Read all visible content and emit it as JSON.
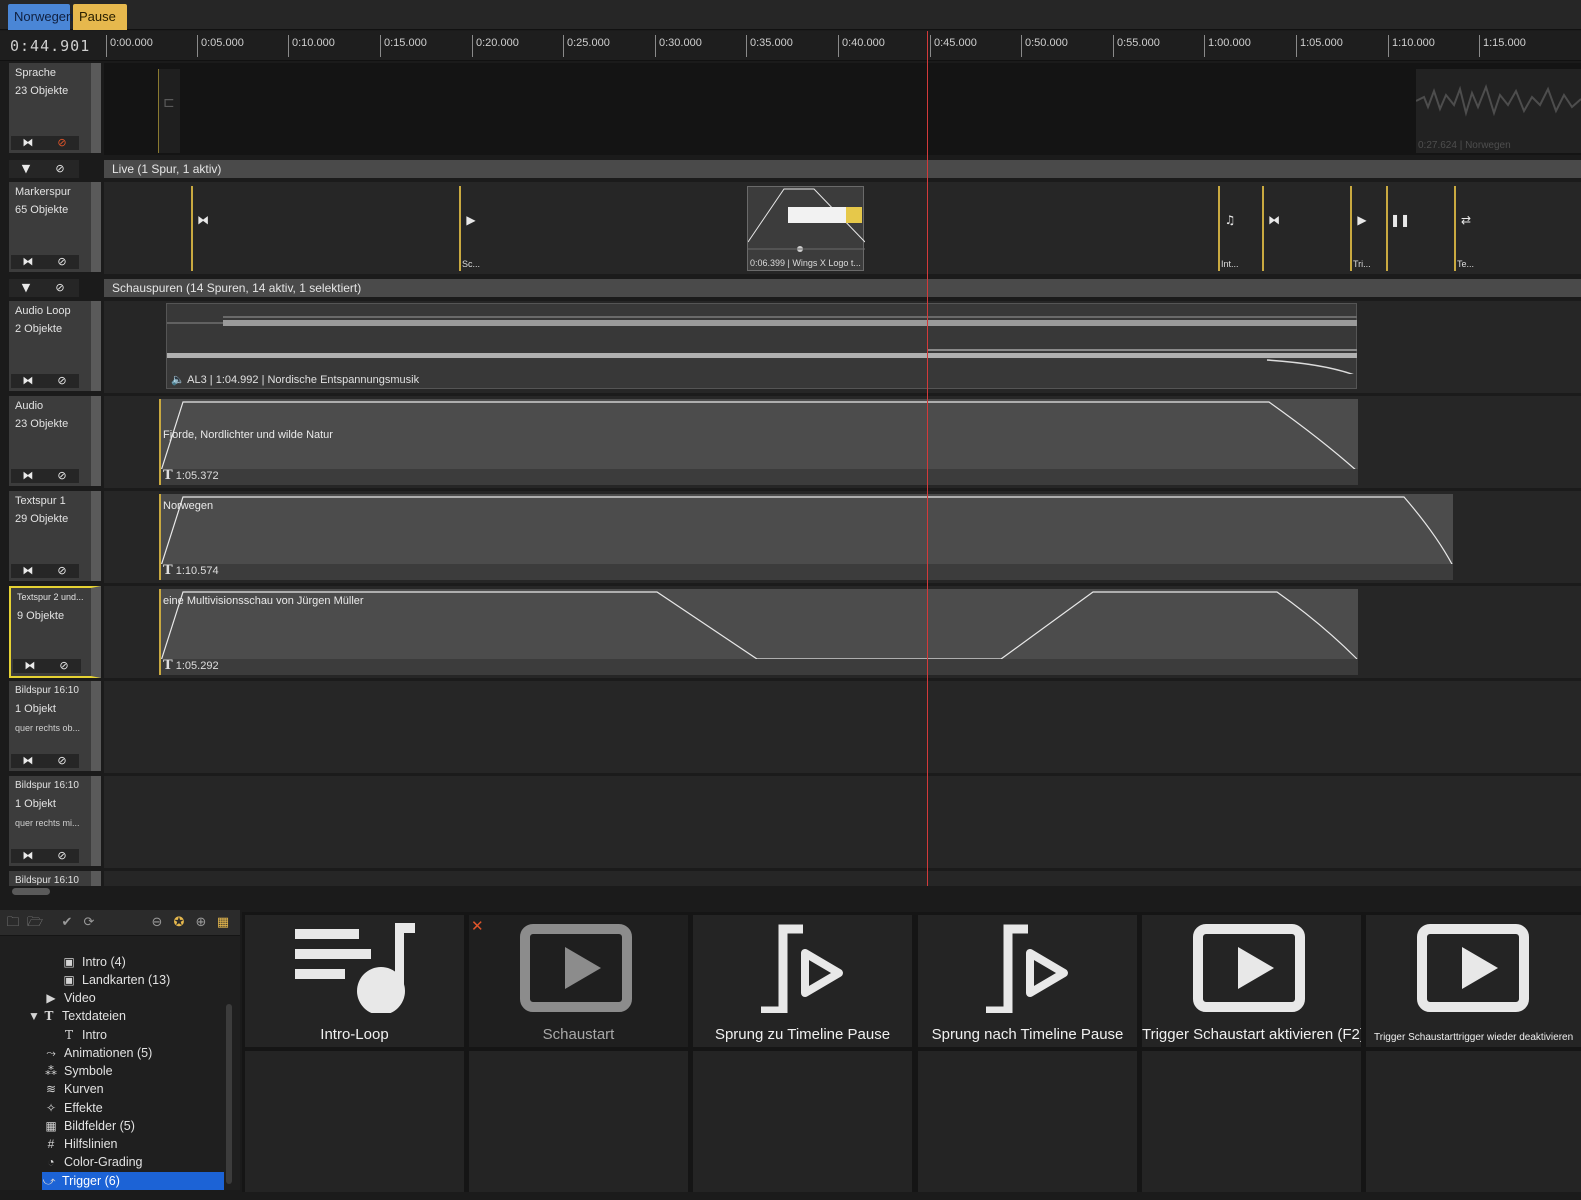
{
  "tabs": [
    {
      "label": "Norwegen"
    },
    {
      "label": "Pause"
    }
  ],
  "timeline": {
    "current_time": "0:44.901",
    "ticks": [
      "0:00.000",
      "0:05.000",
      "0:10.000",
      "0:15.000",
      "0:20.000",
      "0:25.000",
      "0:30.000",
      "0:35.000",
      "0:40.000",
      "0:45.000",
      "0:50.000",
      "0:55.000",
      "1:00.000",
      "1:05.000",
      "1:10.000",
      "1:15.000"
    ]
  },
  "tracks": {
    "sprache": {
      "name": "Sprache",
      "count": "23 Objekte",
      "clip_caption": "0:27.624 | Norwegen"
    },
    "live_group": {
      "label": "Live  (1 Spur, 1 aktiv)"
    },
    "marker": {
      "name": "Markerspur",
      "count": "65 Objekte",
      "markers": [
        {
          "label": ""
        },
        {
          "label": "Sc..."
        },
        {
          "label": "Int..."
        },
        {
          "label": ""
        },
        {
          "label": "Tri..."
        },
        {
          "label": ""
        },
        {
          "label": "Te..."
        }
      ],
      "logo_clip_caption": "0:06.399 | Wings X Logo t..."
    },
    "show_group": {
      "label": "Schauspuren  (14 Spuren, 14 aktiv, 1 selektiert)"
    },
    "audio_loop": {
      "name": "Audio Loop",
      "count": "2 Objekte",
      "caption": "AL3  |  1:04.992  |  Nordische Entspannungsmusik"
    },
    "audio": {
      "name": "Audio",
      "count": "23 Objekte",
      "clip_title": "Fjorde, Nordlichter und wilde Natur",
      "clip_time": "1:05.372"
    },
    "text1": {
      "name": "Textspur 1",
      "count": "29 Objekte",
      "clip_title": "Norwegen",
      "clip_time": "1:10.574"
    },
    "text2": {
      "name": "Textspur 2 und...",
      "count": "9 Objekte",
      "clip_title": "eine Multivisionsschau von Jürgen Müller",
      "clip_time": "1:05.292"
    },
    "bild1": {
      "name": "Bildspur 16:10",
      "count": "1 Objekt",
      "sub": "quer rechts ob..."
    },
    "bild2": {
      "name": "Bildspur 16:10",
      "count": "1 Objekt",
      "sub": "quer rechts mi..."
    },
    "bild3": {
      "name": "Bildspur 16:10"
    }
  },
  "tree": [
    {
      "label": "Intro (4)",
      "icon": "image-icon"
    },
    {
      "label": "Landkarten (13)",
      "icon": "image-icon"
    },
    {
      "label": "Video",
      "icon": "video-icon"
    },
    {
      "label": "Textdateien",
      "icon": "text-icon"
    },
    {
      "label": "Intro",
      "icon": "text-icon"
    },
    {
      "label": "Animationen (5)",
      "icon": "animation-icon"
    },
    {
      "label": "Symbole",
      "icon": "symbol-icon"
    },
    {
      "label": "Kurven",
      "icon": "curve-icon"
    },
    {
      "label": "Effekte",
      "icon": "effect-icon"
    },
    {
      "label": "Bildfelder (5)",
      "icon": "grid-icon"
    },
    {
      "label": "Hilfslinien",
      "icon": "hash-icon"
    },
    {
      "label": "Color-Grading",
      "icon": "palette-icon"
    },
    {
      "label": "Trigger (6)",
      "icon": "trigger-icon"
    }
  ],
  "assets": [
    {
      "label": "Intro-Loop",
      "icon": "playlist-music-icon"
    },
    {
      "label": "Schaustart",
      "icon": "play-box-icon"
    },
    {
      "label": "Sprung zu Timeline Pause",
      "icon": "jump-trigger-icon"
    },
    {
      "label": "Sprung nach Timeline Pause",
      "icon": "jump-trigger-icon"
    },
    {
      "label": "Trigger Schaustart aktivieren (F2)",
      "icon": "play-box-icon"
    },
    {
      "label": "Trigger Schaustarttrigger wieder deaktivieren",
      "icon": "play-box-icon"
    }
  ],
  "colors": {
    "accent_blue": "#4a86d6",
    "accent_yellow": "#e6b84d",
    "playhead": "#d23a3a",
    "selection": "#1c63d6"
  }
}
